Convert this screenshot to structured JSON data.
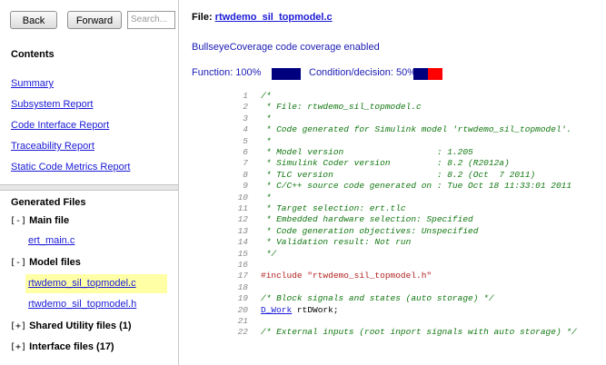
{
  "nav": {
    "back_label": "Back",
    "forward_label": "Forward",
    "search_placeholder": "Search...",
    "contents_heading": "Contents",
    "links": [
      "Summary",
      "Subsystem Report",
      "Code Interface Report",
      "Traceability Report",
      "Static Code Metrics Report"
    ],
    "generated_heading": "Generated Files",
    "groups": [
      {
        "toggle": "[-]",
        "label": "Main file",
        "files": [
          "ert_main.c"
        ]
      },
      {
        "toggle": "[-]",
        "label": "Model files",
        "files": [
          "rtwdemo_sil_topmodel.c",
          "rtwdemo_sil_topmodel.h"
        ]
      },
      {
        "toggle": "[+]",
        "label": "Shared Utility files (1)"
      },
      {
        "toggle": "[+]",
        "label": "Interface files (17)"
      }
    ],
    "selected_file": "rtwdemo_sil_topmodel.c",
    "highlight_color": "#ffffa6"
  },
  "content": {
    "file_prefix": "File: ",
    "file_name": "rtwdemo_sil_topmodel.c",
    "coverage_enabled": "BullseyeCoverage code coverage enabled",
    "function_label": "Function: 100%",
    "function_coverage_pct": 100,
    "condition_label": "Condition/decision: 50%",
    "condition_coverage_pct": 50,
    "covered_color": "#00007f",
    "uncovered_color": "#ff0000",
    "code_lines": [
      {
        "n": "1",
        "t": "/*",
        "k": "cm"
      },
      {
        "n": "2",
        "t": " * File: rtwdemo_sil_topmodel.c",
        "k": "cm"
      },
      {
        "n": "3",
        "t": " *",
        "k": "cm"
      },
      {
        "n": "4",
        "t": " * Code generated for Simulink model 'rtwdemo_sil_topmodel'.",
        "k": "cm"
      },
      {
        "n": "5",
        "t": " *",
        "k": "cm"
      },
      {
        "n": "6",
        "t": " * Model version                  : 1.205",
        "k": "cm"
      },
      {
        "n": "7",
        "t": " * Simulink Coder version         : 8.2 (R2012a)",
        "k": "cm"
      },
      {
        "n": "8",
        "t": " * TLC version                    : 8.2 (Oct  7 2011)",
        "k": "cm"
      },
      {
        "n": "9",
        "t": " * C/C++ source code generated on : Tue Oct 18 11:33:01 2011",
        "k": "cm"
      },
      {
        "n": "10",
        "t": " *",
        "k": "cm"
      },
      {
        "n": "11",
        "t": " * Target selection: ert.tlc",
        "k": "cm"
      },
      {
        "n": "12",
        "t": " * Embedded hardware selection: Specified",
        "k": "cm"
      },
      {
        "n": "13",
        "t": " * Code generation objectives: Unspecified",
        "k": "cm"
      },
      {
        "n": "14",
        "t": " * Validation result: Not run",
        "k": "cm"
      },
      {
        "n": "15",
        "t": " */",
        "k": "cm"
      },
      {
        "n": "16",
        "t": "",
        "k": "cm"
      },
      {
        "n": "17",
        "t": "#include \"rtwdemo_sil_topmodel.h\"",
        "k": "pp"
      },
      {
        "n": "18",
        "t": "",
        "k": "cm"
      },
      {
        "n": "19",
        "t": "/* Block signals and states (auto storage) */",
        "k": "cm"
      },
      {
        "n": "20",
        "t": "D_Work rtDWork;",
        "k": "link",
        "link": "D_Work",
        "rest": " rtDWork;"
      },
      {
        "n": "21",
        "t": "",
        "k": "cm"
      },
      {
        "n": "22",
        "t": "/* External inputs (root inport signals with auto storage) */",
        "k": "cm"
      }
    ]
  }
}
